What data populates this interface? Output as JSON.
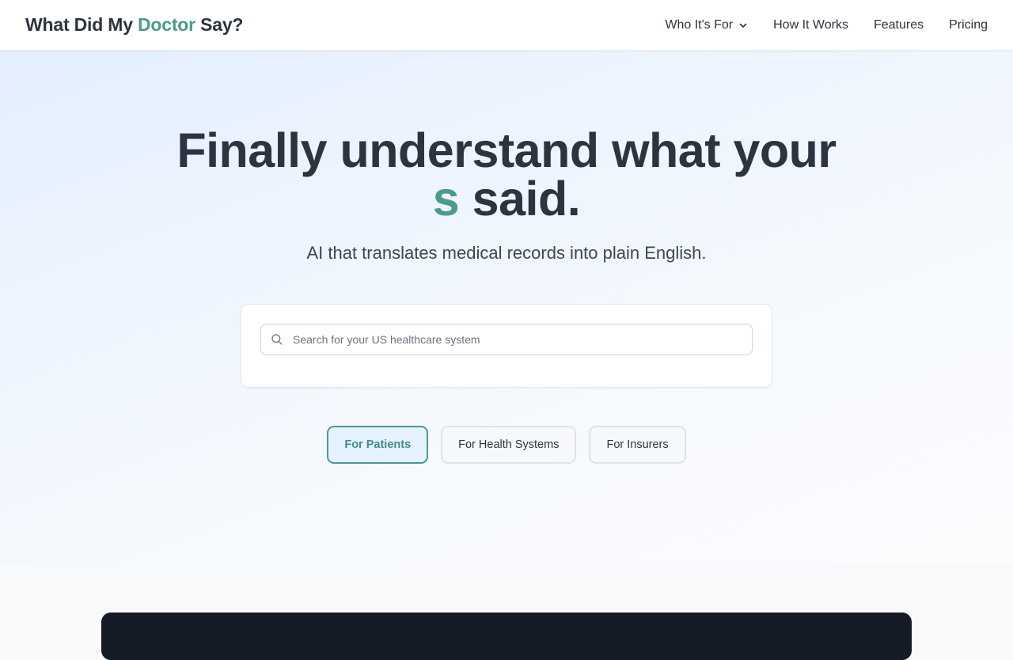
{
  "header": {
    "logo": {
      "prefix": "What Did My ",
      "accent": "Doctor",
      "suffix": " Say?"
    },
    "nav": [
      {
        "label": "Who It's For",
        "icon": "chevron-down-icon"
      },
      {
        "label": "How It Works"
      },
      {
        "label": "Features"
      },
      {
        "label": "Pricing"
      }
    ]
  },
  "hero": {
    "headline_line1": "Finally understand what your",
    "headline_accent": "s",
    "headline_rest": " said.",
    "subhead": "AI that translates medical records into plain English.",
    "search": {
      "placeholder": "Search for your US healthcare system",
      "value": "",
      "icon": "search-icon"
    },
    "audience_tabs": [
      {
        "label": "For Patients",
        "active": true
      },
      {
        "label": "For Health Systems",
        "active": false
      },
      {
        "label": "For Insurers",
        "active": false
      }
    ]
  },
  "colors": {
    "accent": "#4a9a8e",
    "text": "#2d3340",
    "active_tab_bg": "#e6f2fd",
    "dark_panel": "#141a26"
  }
}
